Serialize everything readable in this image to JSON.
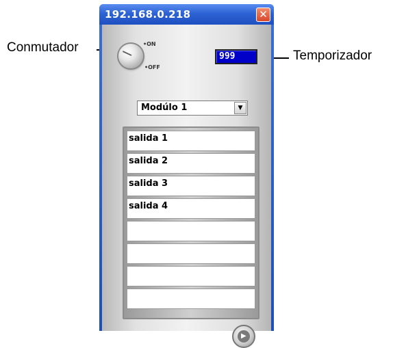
{
  "window": {
    "title": "192.168.0.218",
    "close_glyph": "✕"
  },
  "switch": {
    "on_label": "•ON",
    "off_label": "•OFF"
  },
  "timer": {
    "value": "999"
  },
  "module_select": {
    "selected": "Modúlo 1",
    "arrow": "▼"
  },
  "outputs": {
    "items": [
      "salida 1",
      "salida 2",
      "salida 3",
      "salida 4",
      "",
      "",
      "",
      ""
    ]
  },
  "play_button": {
    "glyph": "▶"
  },
  "callouts": {
    "switch_label": "Conmutador",
    "timer_label": "Temporizador"
  },
  "colors": {
    "titlebar": "#2d63d4",
    "timer_bg": "#0000c8",
    "close_button": "#d8462a"
  },
  "icons": [
    "rotary-switch-icon",
    "close-icon",
    "dropdown-arrow-icon",
    "play-icon"
  ]
}
